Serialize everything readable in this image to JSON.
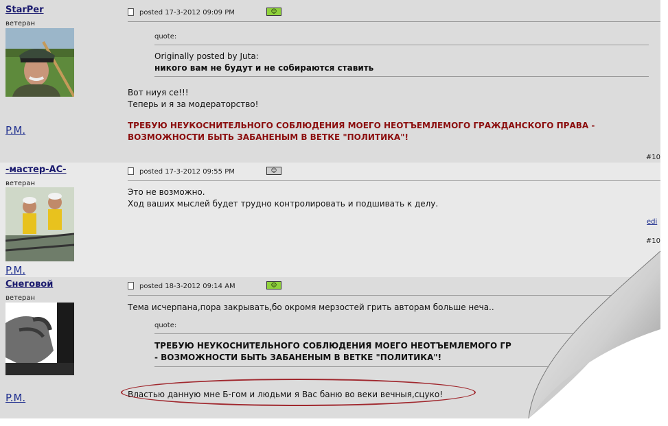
{
  "posts": [
    {
      "username": "StarPer",
      "rank": "ветеран",
      "pm": "P.M.",
      "posted": "posted 17-3-2012 09:09 PM",
      "status_icon": "online-status-icon",
      "quote_label": "quote:",
      "quote_author": "Originally posted by Juta:",
      "quote_text": "никого вам не будут и не собираются ставить",
      "body_line1": "Вот ниуя се!!!",
      "body_line2": "Теперь и я за модераторство!",
      "red_line1": "ТРЕБУЮ НЕУКОСНИТЕЛЬНОГО СОБЛЮДЕНИЯ МОЕГО НЕОТЪЕМЛЕМОГО ГРАЖДАНСКОГО ПРАВА -",
      "red_line2": "ВОЗМОЖНОСТИ БЫТЬ ЗАБАНЕНЫМ В ВЕТКЕ \"ПОЛИТИКА\"!",
      "post_number": "#10"
    },
    {
      "username": "-мастер-АС-",
      "rank": "ветеран",
      "pm": "P.M.",
      "posted": "posted 17-3-2012 09:55 PM",
      "status_icon": "offline-status-icon",
      "body_line1": "Это не возможно.",
      "body_line2": "Ход ваших мыслей будет трудно контролировать и подшивать к делу.",
      "edit_label": "edi",
      "post_number": "#10"
    },
    {
      "username": "Снеговой",
      "rank": "ветеран",
      "pm": "P.M.",
      "posted": "posted 18-3-2012 09:14 AM",
      "status_icon": "online-status-icon",
      "body_line1": "Тема исчерпана,пора закрывать,бо окромя мерзостей грить авторам больше неча..",
      "quote_label": "quote:",
      "quote_line1": "ТРЕБУЮ НЕУКОСНИТЕЛЬНОГО СОБЛЮДЕНИЯ МОЕГО НЕОТЪЕМЛЕМОГО ГР",
      "quote_line2": "- ВОЗМОЖНОСТИ БЫТЬ ЗАБАНЕНЫМ В ВЕТКЕ \"ПОЛИТИКА\"!",
      "highlighted_text": "Властью данную мне Б-гом и людьми я Вас баню во веки вечныя,сцуко!"
    }
  ],
  "colors": {
    "username": "#1a1a6e",
    "red_text": "#8b0e0e",
    "highlight_ellipse": "#a0282e",
    "online_icon": "#8fd13b"
  }
}
